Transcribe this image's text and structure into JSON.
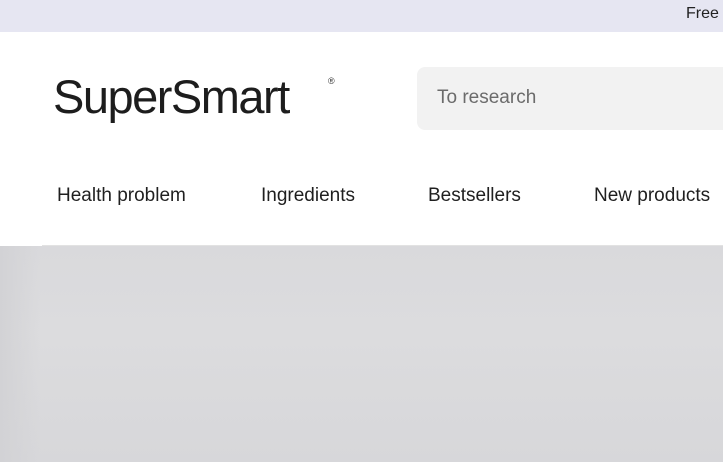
{
  "announcement": {
    "text": "Free"
  },
  "brand": {
    "logo_text": "SuperSmart",
    "logo_mark": "®"
  },
  "search": {
    "placeholder": "To research",
    "value": ""
  },
  "nav": {
    "items": [
      {
        "label": "Health problem"
      },
      {
        "label": "Ingredients"
      },
      {
        "label": "Bestsellers"
      },
      {
        "label": "New products"
      }
    ]
  },
  "colors": {
    "announcement_bg": "#e6e6f2",
    "search_bg": "#f2f2f2",
    "hero_bg": "#d9d9dc"
  }
}
